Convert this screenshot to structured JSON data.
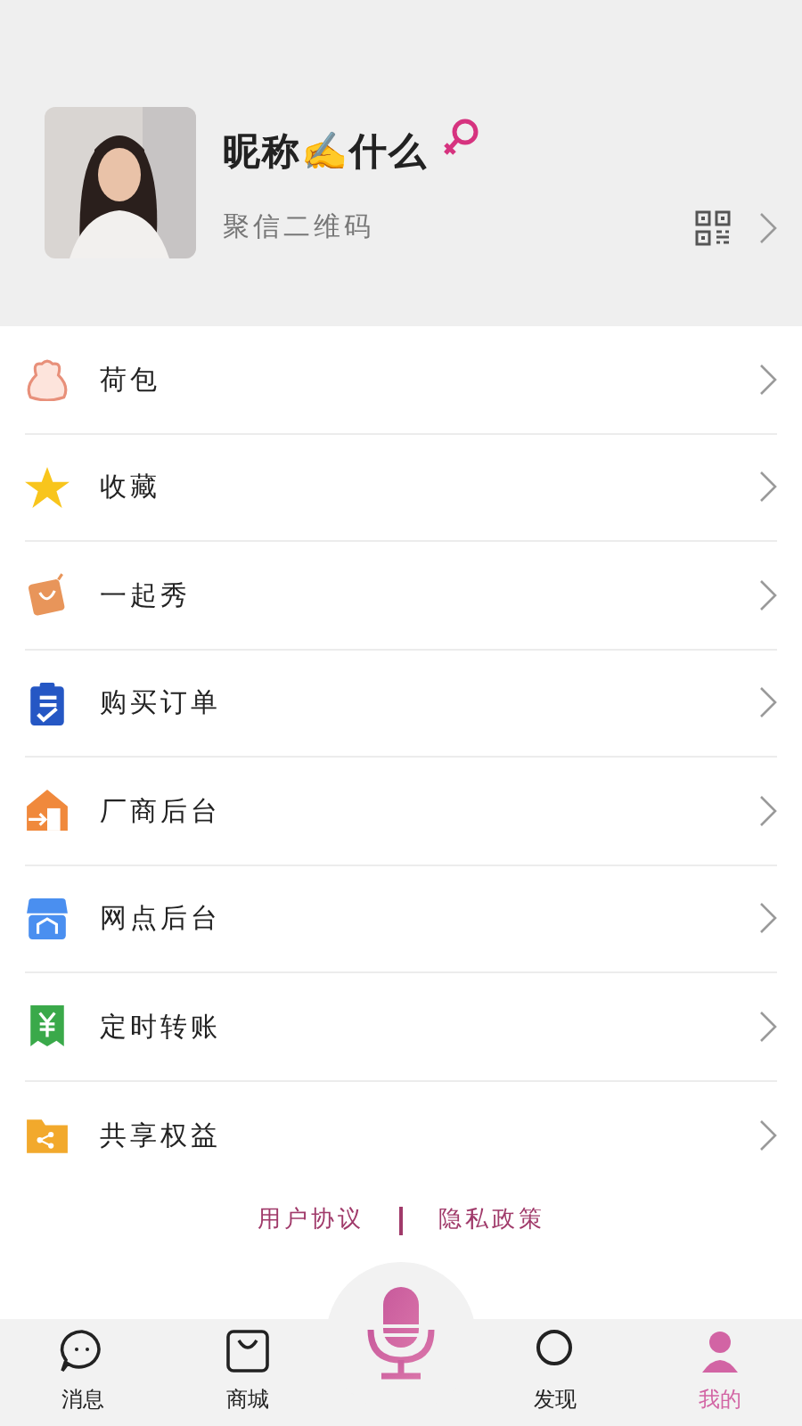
{
  "profile": {
    "nickname": "昵称✍什么",
    "gender_mark": {
      "kind": "female"
    },
    "subtitle": "聚信二维码"
  },
  "menu": [
    {
      "label": "荷包"
    },
    {
      "label": "收藏"
    },
    {
      "label": "一起秀"
    },
    {
      "label": "购买订单"
    },
    {
      "label": "厂商后台"
    },
    {
      "label": "网点后台"
    },
    {
      "label": "定时转账"
    },
    {
      "label": "共享权益"
    }
  ],
  "footer_links": [
    "用户协议",
    "隐私政策"
  ],
  "tabs": [
    {
      "label": "消息",
      "selected": false
    },
    {
      "label": "商城",
      "selected": false
    },
    {
      "label": "发现",
      "selected": false
    },
    {
      "label": "我的",
      "selected": true
    }
  ]
}
